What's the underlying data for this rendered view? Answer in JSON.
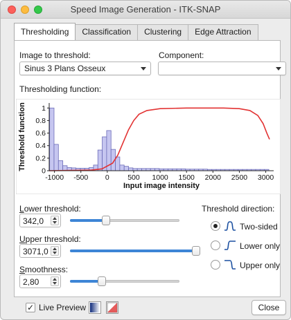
{
  "window": {
    "title": "Speed Image Generation - ITK-SNAP"
  },
  "tabs": [
    {
      "label": "Thresholding",
      "active": true
    },
    {
      "label": "Classification",
      "active": false
    },
    {
      "label": "Clustering",
      "active": false
    },
    {
      "label": "Edge Attraction",
      "active": false
    }
  ],
  "image_select": {
    "label": "Image to threshold:",
    "value": "Sinus 3 Plans Osseux"
  },
  "component_select": {
    "label": "Component:",
    "value": ""
  },
  "threshold_function": {
    "label": "Thresholding function:"
  },
  "chart_data": {
    "type": "bar",
    "xlabel": "Input image intensity",
    "ylabel": "Threshold function",
    "xlim": [
      -1100,
      3150
    ],
    "ylim": [
      0,
      1.08
    ],
    "xticks": [
      -1000,
      -500,
      0,
      500,
      1000,
      1500,
      2000,
      2500,
      3000
    ],
    "yticks": [
      0,
      0.2,
      0.4,
      0.6,
      0.8,
      1
    ],
    "bin_width": 83,
    "histogram_bins": [
      {
        "x": -1050,
        "y": 1.0
      },
      {
        "x": -967,
        "y": 0.42
      },
      {
        "x": -884,
        "y": 0.16
      },
      {
        "x": -801,
        "y": 0.08
      },
      {
        "x": -718,
        "y": 0.05
      },
      {
        "x": -635,
        "y": 0.045
      },
      {
        "x": -552,
        "y": 0.04
      },
      {
        "x": -469,
        "y": 0.04
      },
      {
        "x": -386,
        "y": 0.04
      },
      {
        "x": -303,
        "y": 0.05
      },
      {
        "x": -220,
        "y": 0.09
      },
      {
        "x": -137,
        "y": 0.33
      },
      {
        "x": -54,
        "y": 0.54
      },
      {
        "x": 29,
        "y": 0.64
      },
      {
        "x": 112,
        "y": 0.34
      },
      {
        "x": 195,
        "y": 0.22
      },
      {
        "x": 278,
        "y": 0.09
      },
      {
        "x": 361,
        "y": 0.07
      },
      {
        "x": 444,
        "y": 0.045
      },
      {
        "x": 527,
        "y": 0.035
      },
      {
        "x": 610,
        "y": 0.035
      },
      {
        "x": 693,
        "y": 0.035
      },
      {
        "x": 776,
        "y": 0.035
      },
      {
        "x": 859,
        "y": 0.035
      },
      {
        "x": 942,
        "y": 0.035
      },
      {
        "x": 1025,
        "y": 0.03
      },
      {
        "x": 1108,
        "y": 0.03
      },
      {
        "x": 1191,
        "y": 0.03
      },
      {
        "x": 1274,
        "y": 0.03
      },
      {
        "x": 1357,
        "y": 0.03
      },
      {
        "x": 1440,
        "y": 0.03
      },
      {
        "x": 1523,
        "y": 0.025
      },
      {
        "x": 1606,
        "y": 0.025
      },
      {
        "x": 1689,
        "y": 0.025
      },
      {
        "x": 1772,
        "y": 0.025
      },
      {
        "x": 1855,
        "y": 0.025
      },
      {
        "x": 1938,
        "y": 0.02
      },
      {
        "x": 2021,
        "y": 0.02
      },
      {
        "x": 2104,
        "y": 0.02
      },
      {
        "x": 2187,
        "y": 0.02
      },
      {
        "x": 2270,
        "y": 0.02
      },
      {
        "x": 2353,
        "y": 0.02
      },
      {
        "x": 2436,
        "y": 0.02
      },
      {
        "x": 2519,
        "y": 0.02
      },
      {
        "x": 2602,
        "y": 0.02
      },
      {
        "x": 2685,
        "y": 0.02
      },
      {
        "x": 2768,
        "y": 0.02
      },
      {
        "x": 2851,
        "y": 0.02
      },
      {
        "x": 2934,
        "y": 0.02
      },
      {
        "x": 3017,
        "y": 0.02
      }
    ],
    "threshold_curve": [
      {
        "x": -1100,
        "y": 0
      },
      {
        "x": -300,
        "y": 0.01
      },
      {
        "x": -100,
        "y": 0.03
      },
      {
        "x": 100,
        "y": 0.12
      },
      {
        "x": 200,
        "y": 0.25
      },
      {
        "x": 300,
        "y": 0.45
      },
      {
        "x": 400,
        "y": 0.65
      },
      {
        "x": 500,
        "y": 0.8
      },
      {
        "x": 600,
        "y": 0.9
      },
      {
        "x": 750,
        "y": 0.96
      },
      {
        "x": 1000,
        "y": 0.99
      },
      {
        "x": 1500,
        "y": 1.0
      },
      {
        "x": 2200,
        "y": 1.0
      },
      {
        "x": 2500,
        "y": 0.99
      },
      {
        "x": 2700,
        "y": 0.96
      },
      {
        "x": 2850,
        "y": 0.88
      },
      {
        "x": 2950,
        "y": 0.75
      },
      {
        "x": 3020,
        "y": 0.6
      },
      {
        "x": 3071,
        "y": 0.5
      }
    ],
    "colors": {
      "bars_fill": "#c6c6f0",
      "bars_stroke": "#6b6bb8",
      "curve": "#e23232"
    }
  },
  "lower_threshold": {
    "label_first": "L",
    "label_rest": "ower threshold:",
    "value": "342,0",
    "slider_fraction": 0.32
  },
  "upper_threshold": {
    "label_first": "U",
    "label_rest": "pper threshold:",
    "value": "3071,0",
    "slider_fraction": 1.0
  },
  "smoothness": {
    "label_first": "S",
    "label_rest": "moothness:",
    "value": "2,80",
    "slider_fraction": 0.28
  },
  "direction": {
    "label": "Threshold direction:",
    "options": [
      {
        "label": "Two-sided",
        "checked": true,
        "icon": "two-sided-icon"
      },
      {
        "label": "Lower only",
        "checked": false,
        "icon": "lower-only-icon"
      },
      {
        "label": "Upper only",
        "checked": false,
        "icon": "upper-only-icon"
      }
    ]
  },
  "bottom": {
    "live_preview_label": "Live Preview",
    "live_preview_checked": true,
    "check_mark": "✓",
    "close_label": "Close"
  },
  "colors": {
    "accent": "#3d85d6"
  }
}
